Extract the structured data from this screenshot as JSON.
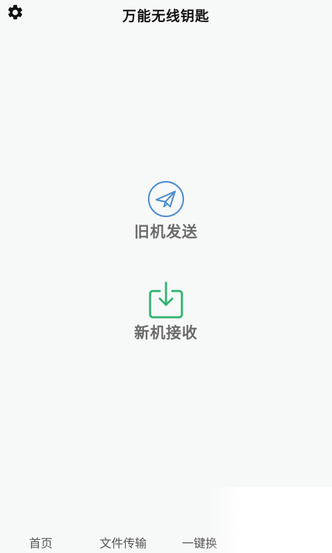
{
  "app": {
    "title": "万能无线钥匙"
  },
  "icons": {
    "settings": "gear-icon",
    "send": "paper-plane-icon",
    "receive": "download-tray-icon"
  },
  "colors": {
    "send_icon": "#4f8ed0",
    "receive_icon": "#2fb46e"
  },
  "actions": {
    "send_label": "旧机发送",
    "receive_label": "新机接收"
  },
  "tabs": [
    {
      "label": "首页"
    },
    {
      "label": "文件传输"
    },
    {
      "label": "一键换"
    }
  ]
}
